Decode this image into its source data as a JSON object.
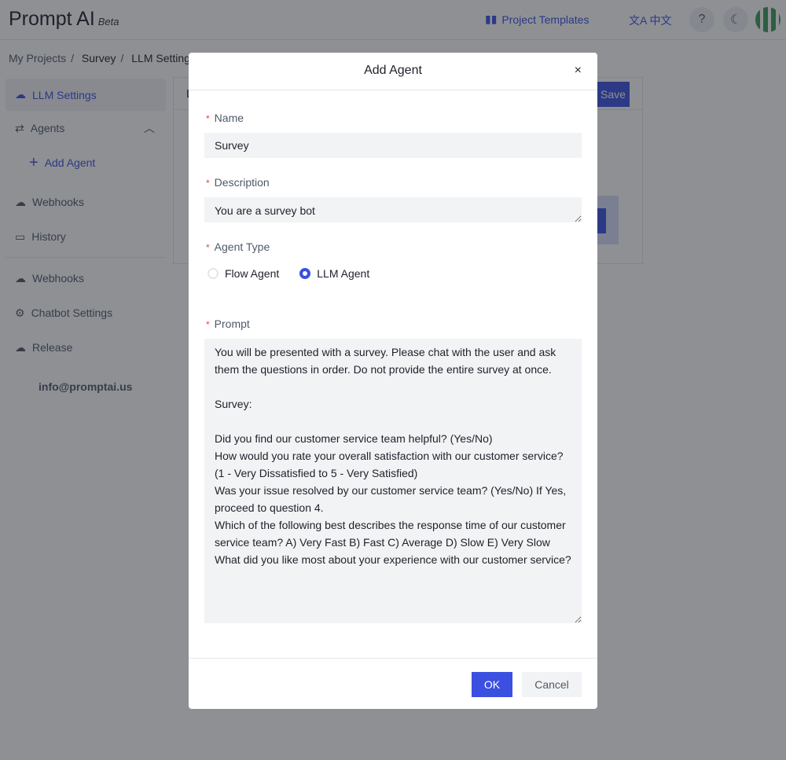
{
  "header": {
    "logo": "Prompt AI",
    "beta": "Beta",
    "templates": "Project Templates",
    "lang": "中文",
    "help": "?",
    "theme": "☾"
  },
  "breadcrumb": [
    "My Projects",
    "Survey",
    "LLM Settings"
  ],
  "sidebar": {
    "items": [
      {
        "label": "LLM Settings",
        "icon": "cloud-icon"
      },
      {
        "label": "Agents",
        "icon": "share-icon"
      },
      {
        "label": "Add Agent",
        "icon": "plus-icon"
      },
      {
        "label": "Webhooks",
        "icon": "cloud-icon"
      },
      {
        "label": "History",
        "icon": "chat-icon"
      },
      {
        "label": "Webhooks",
        "icon": "cloud-icon"
      },
      {
        "label": "Chatbot Settings",
        "icon": "gear-icon"
      },
      {
        "label": "Release",
        "icon": "cloud-upload-icon"
      }
    ],
    "email": "info@promptai.us"
  },
  "panel": {
    "title": "L",
    "save": "Save"
  },
  "modal": {
    "title": "Add Agent",
    "close": "×",
    "name_label": "Name",
    "name_value": "Survey",
    "desc_label": "Description",
    "desc_value": "You are a survey bot",
    "type_label": "Agent Type",
    "types": [
      "Flow Agent",
      "LLM Agent"
    ],
    "selected_type": "LLM Agent",
    "prompt_label": "Prompt",
    "prompt_value": "You will be presented with a survey. Please chat with the user and ask them the questions in order. Do not provide the entire survey at once.\n\nSurvey:\n\nDid you find our customer service team helpful? (Yes/No)\nHow would you rate your overall satisfaction with our customer service? (1 - Very Dissatisfied to 5 - Very Satisfied)\nWas your issue resolved by our customer service team? (Yes/No) If Yes, proceed to question 4.\nWhich of the following best describes the response time of our customer service team? A) Very Fast B) Fast C) Average D) Slow E) Very Slow\nWhat did you like most about your experience with our customer service?",
    "ok": "OK",
    "cancel": "Cancel"
  },
  "colors": {
    "accent": "#3b50e0",
    "required": "#f53f3f"
  }
}
